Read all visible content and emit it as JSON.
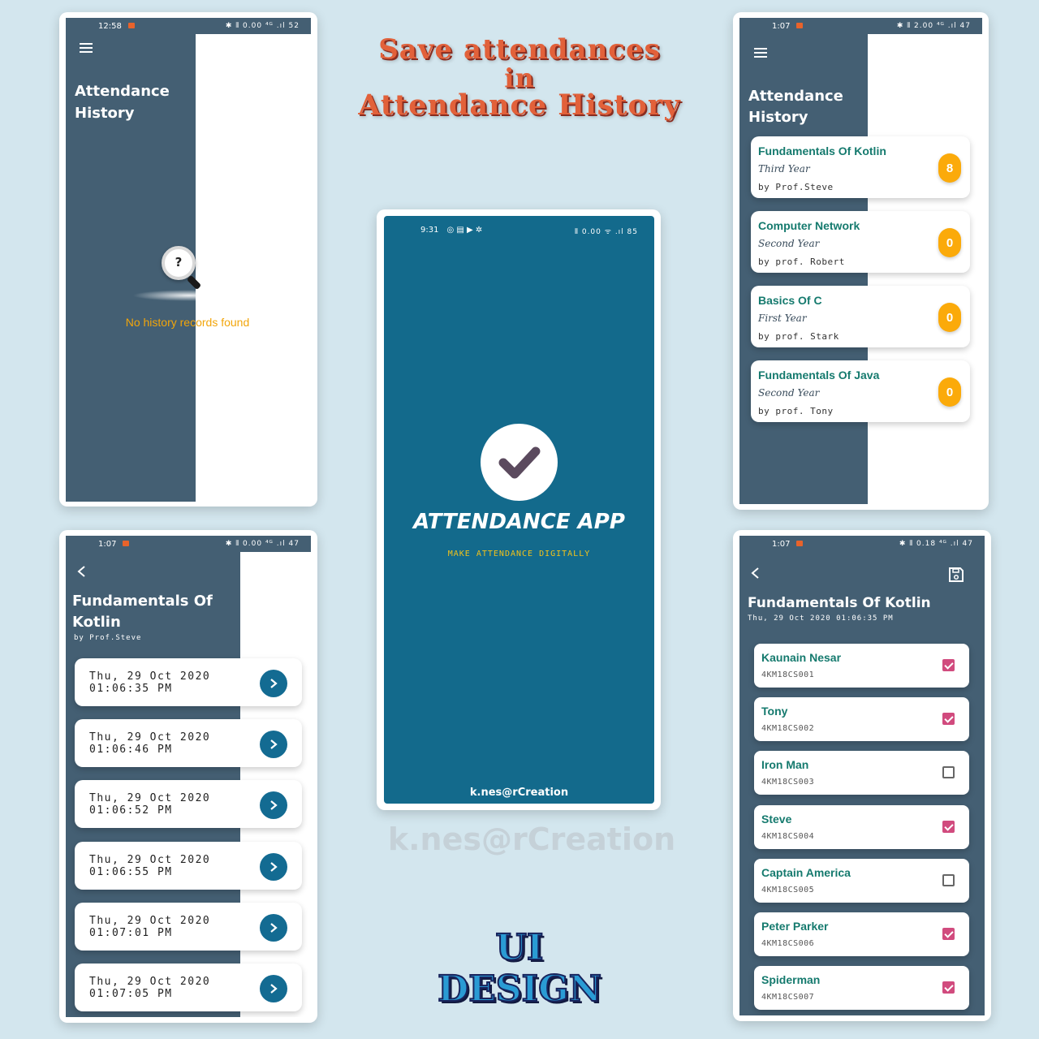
{
  "heading": {
    "line1": "Save attendances",
    "line2": "in",
    "line3": "Attendance History"
  },
  "watermark": "k.nes@rCreation",
  "ui_design_label": "UI DESIGN",
  "screen_empty": {
    "time": "12:58",
    "status_icons": "✱ ⦀ 0.00 ⁴ᴳ .ıl 52",
    "title_line1": "Attendance",
    "title_line2": "History",
    "empty_text": "No history records found",
    "empty_glyph": "?"
  },
  "screen_history": {
    "time": "1:07",
    "status_icons": "✱ ⦀ 2.00 ⁴ᴳ .ıl 47",
    "title_line1": "Attendance",
    "title_line2": "History",
    "courses": [
      {
        "name": "Fundamentals Of Kotlin",
        "year": "Third Year",
        "by": "by Prof.Steve",
        "count": "8"
      },
      {
        "name": "Computer Network",
        "year": "Second Year",
        "by": "by prof. Robert",
        "count": "0"
      },
      {
        "name": "Basics Of C",
        "year": "First Year",
        "by": "by prof. Stark",
        "count": "0"
      },
      {
        "name": "Fundamentals Of Java",
        "year": "Second Year",
        "by": "by prof. Tony",
        "count": "0"
      }
    ]
  },
  "screen_splash": {
    "time": "9:31",
    "status_icons": "⦀ 0.00 ᯤ .ıl 85",
    "app_name": "ATTENDANCE APP",
    "tagline": "MAKE ATTENDANCE DIGITALLY",
    "footer": "k.nes@rCreation"
  },
  "screen_sessions": {
    "time": "1:07",
    "status_icons": "✱ ⦀ 0.00 ⁴ᴳ .ıl 47",
    "title_line1": "Fundamentals Of",
    "title_line2": "Kotlin",
    "subtitle": "by Prof.Steve",
    "sessions": [
      {
        "date": "Thu, 29 Oct 2020",
        "time": "01:06:35 PM"
      },
      {
        "date": "Thu, 29 Oct 2020",
        "time": "01:06:46 PM"
      },
      {
        "date": "Thu, 29 Oct 2020",
        "time": "01:06:52 PM"
      },
      {
        "date": "Thu, 29 Oct 2020",
        "time": "01:06:55 PM"
      },
      {
        "date": "Thu, 29 Oct 2020",
        "time": "01:07:01 PM"
      },
      {
        "date": "Thu, 29 Oct 2020",
        "time": "01:07:05 PM"
      }
    ]
  },
  "screen_students": {
    "time": "1:07",
    "status_icons": "✱ ⦀ 0.18 ⁴ᴳ .ıl 47",
    "title": "Fundamentals Of Kotlin",
    "subtitle": "Thu, 29 Oct 2020 01:06:35 PM",
    "students": [
      {
        "name": "Kaunain Nesar",
        "id": "4KM18CS001",
        "present": true
      },
      {
        "name": "Tony",
        "id": "4KM18CS002",
        "present": true
      },
      {
        "name": "Iron Man",
        "id": "4KM18CS003",
        "present": false
      },
      {
        "name": "Steve",
        "id": "4KM18CS004",
        "present": true
      },
      {
        "name": "Captain America",
        "id": "4KM18CS005",
        "present": false
      },
      {
        "name": "Peter Parker",
        "id": "4KM18CS006",
        "present": true
      },
      {
        "name": "Spiderman",
        "id": "4KM18CS007",
        "present": true
      }
    ]
  },
  "colors": {
    "dark_panel": "#445f73",
    "splash_bg": "#136a8c",
    "accent_green": "#157a6e",
    "badge": "#fbaa0a",
    "check": "#d14b7e"
  }
}
